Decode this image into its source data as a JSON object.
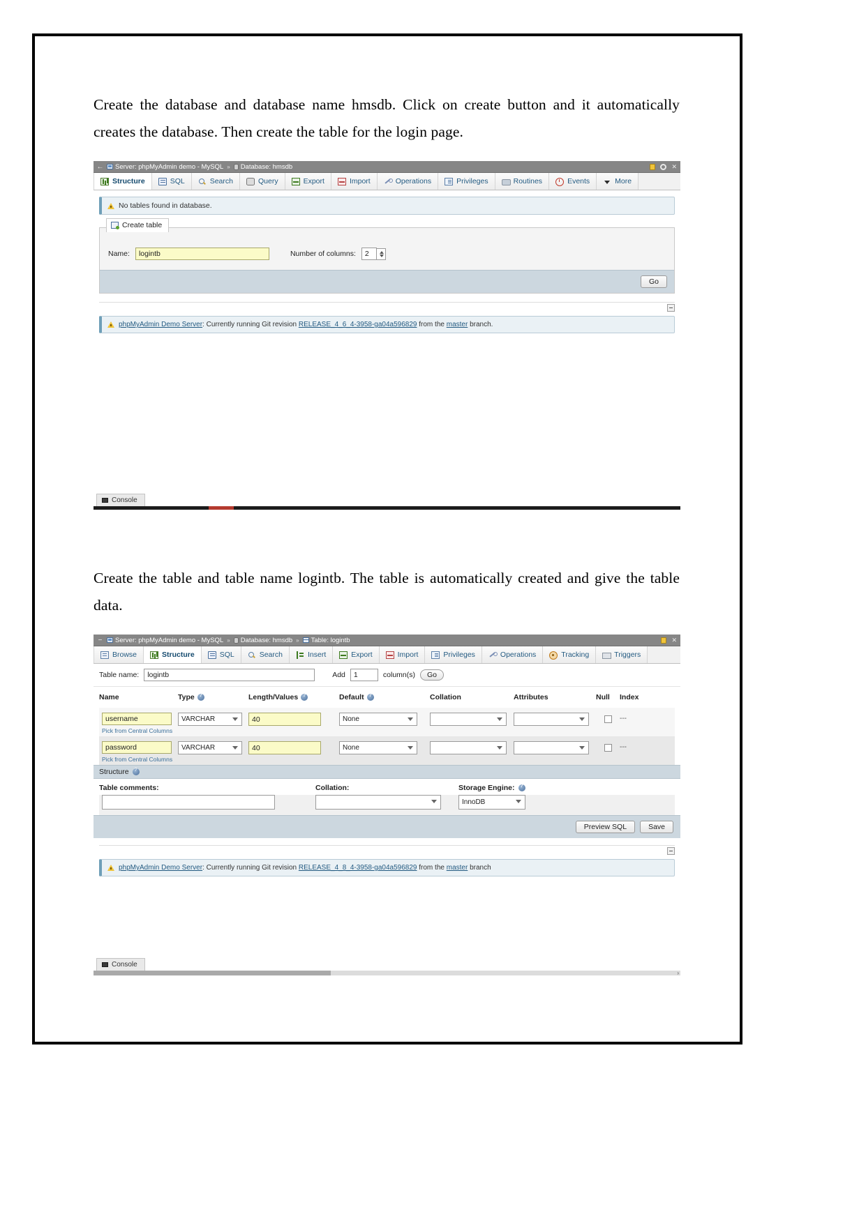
{
  "document": {
    "paragraph1": "Create the database and database name hmsdb. Click on create button and it automatically creates the database. Then create the table for the login page.",
    "paragraph2": "Create the table and table name logintb. The table is automatically created and give the table data."
  },
  "screenshot1": {
    "breadcrumb": {
      "server_label": "Server: phpMyAdmin demo - MySQL",
      "separator": "»",
      "database_label": "Database: hmsdb"
    },
    "tabs": [
      {
        "label": "Structure",
        "icon": "structure-icon",
        "active": true
      },
      {
        "label": "SQL",
        "icon": "sql-icon",
        "active": false
      },
      {
        "label": "Search",
        "icon": "search-icon",
        "active": false
      },
      {
        "label": "Query",
        "icon": "query-icon",
        "active": false
      },
      {
        "label": "Export",
        "icon": "export-icon",
        "active": false
      },
      {
        "label": "Import",
        "icon": "import-icon",
        "active": false
      },
      {
        "label": "Operations",
        "icon": "operations-icon",
        "active": false
      },
      {
        "label": "Privileges",
        "icon": "privileges-icon",
        "active": false
      },
      {
        "label": "Routines",
        "icon": "routines-icon",
        "active": false
      },
      {
        "label": "Events",
        "icon": "events-icon",
        "active": false
      },
      {
        "label": "More",
        "icon": "chevron-down-icon",
        "active": false
      }
    ],
    "notice": "No tables found in database.",
    "create_table": {
      "legend": "Create table",
      "name_label": "Name:",
      "name_value": "logintb",
      "columns_label": "Number of columns:",
      "columns_value": "2",
      "go_label": "Go"
    },
    "demo_notice": {
      "link_text": "phpMyAdmin Demo Server",
      "text_before": ": Currently running Git revision ",
      "revision": "RELEASE_4_6_4-3958-ga04a596829",
      "text_middle": " from the ",
      "branch": "master",
      "text_after": " branch."
    },
    "console_label": "Console"
  },
  "screenshot2": {
    "breadcrumb": {
      "server_label": "Server: phpMyAdmin demo - MySQL",
      "separator": "»",
      "database_label": "Database: hmsdb",
      "table_label": "Table: logintb"
    },
    "tabs": [
      {
        "label": "Browse",
        "icon": "browse-icon",
        "active": false
      },
      {
        "label": "Structure",
        "icon": "structure-icon",
        "active": true
      },
      {
        "label": "SQL",
        "icon": "sql-icon",
        "active": false
      },
      {
        "label": "Search",
        "icon": "search-icon",
        "active": false
      },
      {
        "label": "Insert",
        "icon": "insert-icon",
        "active": false
      },
      {
        "label": "Export",
        "icon": "export-icon",
        "active": false
      },
      {
        "label": "Import",
        "icon": "import-icon",
        "active": false
      },
      {
        "label": "Privileges",
        "icon": "privileges-icon",
        "active": false
      },
      {
        "label": "Operations",
        "icon": "operations-icon",
        "active": false
      },
      {
        "label": "Tracking",
        "icon": "tracking-icon",
        "active": false
      },
      {
        "label": "Triggers",
        "icon": "triggers-icon",
        "active": false
      }
    ],
    "table_form": {
      "table_name_label": "Table name:",
      "table_name_value": "logintb",
      "add_label": "Add",
      "add_value": "1",
      "columns_label": "column(s)",
      "go_label": "Go"
    },
    "columns_header": {
      "name": "Name",
      "type": "Type",
      "length": "Length/Values",
      "default": "Default",
      "collation": "Collation",
      "attributes": "Attributes",
      "null": "Null",
      "index": "Index"
    },
    "columns": [
      {
        "name": "username",
        "type": "VARCHAR",
        "length": "40",
        "default": "None",
        "collation": "",
        "attributes": "",
        "null": false,
        "index": "---",
        "pick_link": "Pick from Central Columns"
      },
      {
        "name": "password",
        "type": "VARCHAR",
        "length": "40",
        "default": "None",
        "collation": "",
        "attributes": "",
        "null": false,
        "index": "---",
        "pick_link": "Pick from Central Columns"
      }
    ],
    "structure_section": {
      "title": "Structure",
      "table_comments_label": "Table comments:",
      "table_comments_value": "",
      "collation_label": "Collation:",
      "collation_value": "",
      "storage_engine_label": "Storage Engine:",
      "storage_engine_value": "InnoDB"
    },
    "actions": {
      "preview_sql": "Preview SQL",
      "save": "Save"
    },
    "demo_notice": {
      "link_text": "phpMyAdmin Demo Server",
      "text_before": ": Currently running Git revision ",
      "revision": "RELEASE_4_8_4-3958-ga04a596829",
      "text_middle": " from the ",
      "branch": "master",
      "text_after": " branch"
    },
    "console_label": "Console"
  },
  "colors": {
    "topbar": "#868686",
    "tab_link": "#235a81",
    "highlight_field": "#fbfbc8",
    "footer_bar": "#ccd7df",
    "notice_bg": "#eaf1f5"
  }
}
